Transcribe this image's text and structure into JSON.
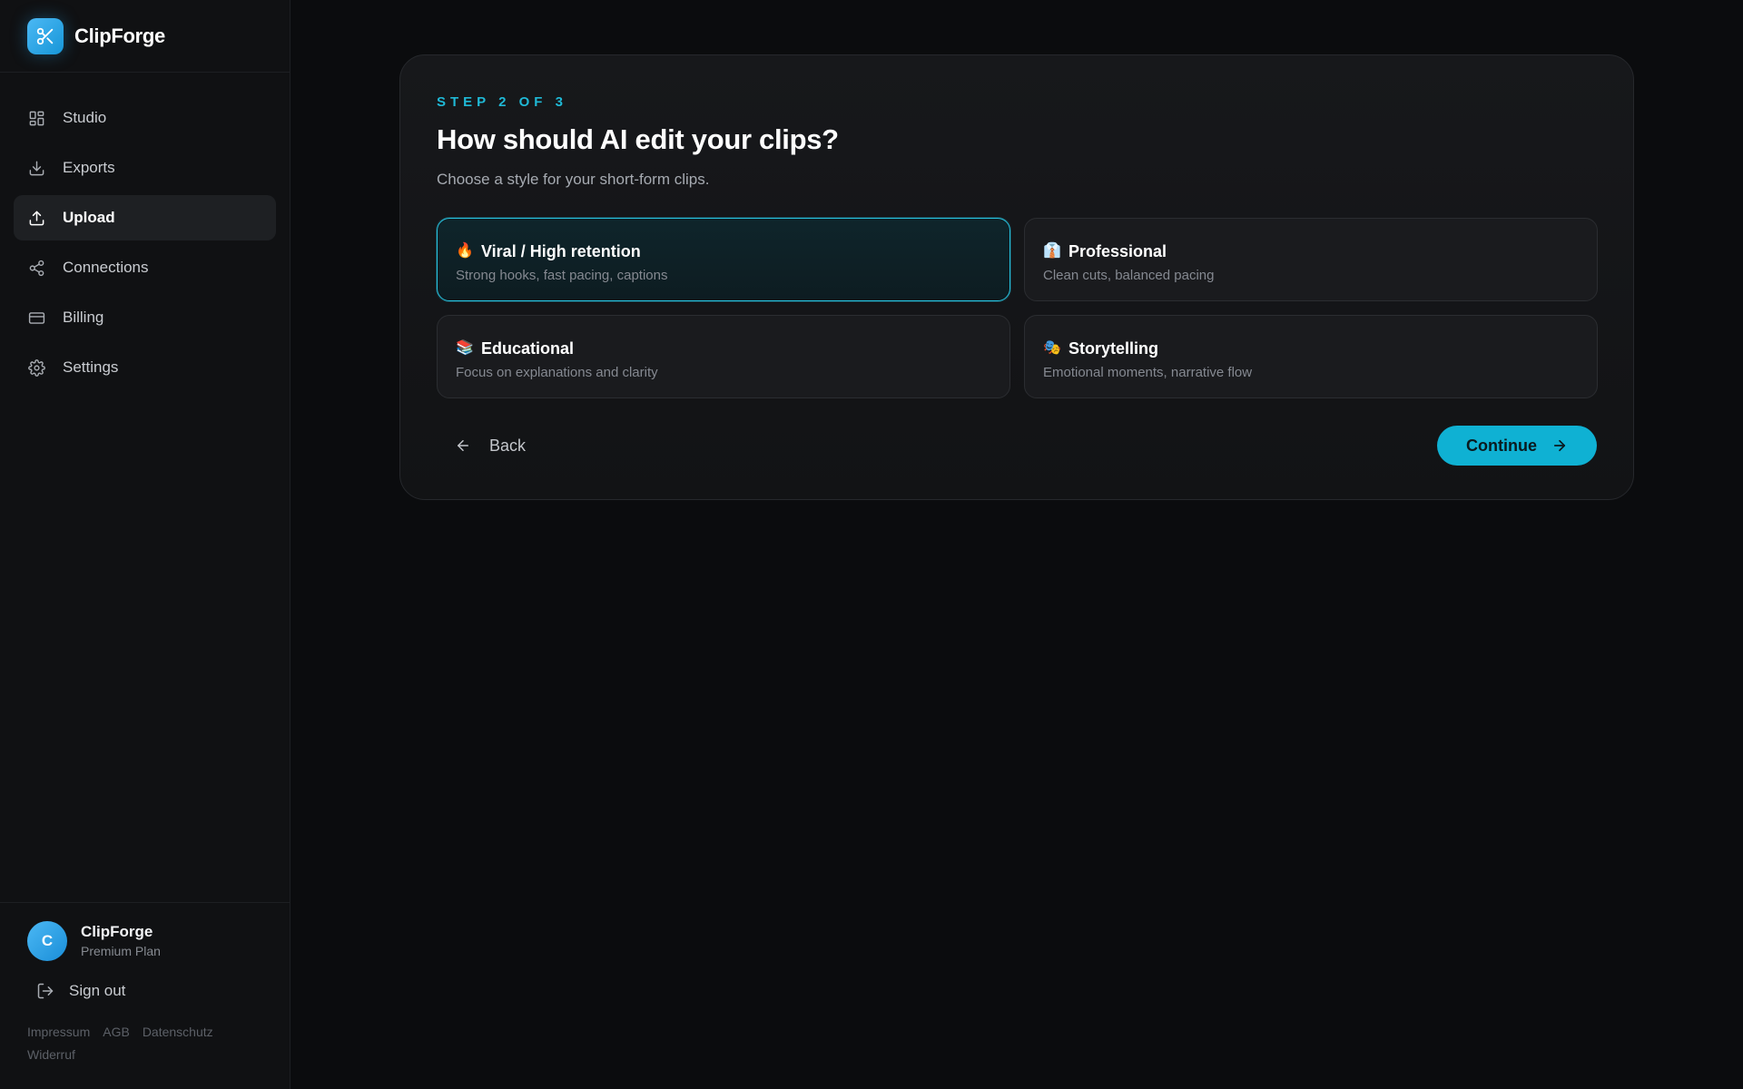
{
  "brand": {
    "name": "ClipForge",
    "logo_icon": "scissors-icon",
    "accent": "#1796d8"
  },
  "sidebar": {
    "items": [
      {
        "label": "Studio",
        "icon": "grid-icon",
        "active": false
      },
      {
        "label": "Exports",
        "icon": "download-icon",
        "active": false
      },
      {
        "label": "Upload",
        "icon": "upload-icon",
        "active": true
      },
      {
        "label": "Connections",
        "icon": "share-icon",
        "active": false
      },
      {
        "label": "Billing",
        "icon": "credit-card-icon",
        "active": false
      },
      {
        "label": "Settings",
        "icon": "gear-icon",
        "active": false
      }
    ]
  },
  "account": {
    "avatar_initial": "C",
    "name": "ClipForge",
    "plan": "Premium Plan"
  },
  "signout": {
    "label": "Sign out",
    "icon": "logout-icon"
  },
  "legal_links": [
    "Impressum",
    "AGB",
    "Datenschutz",
    "Widerruf"
  ],
  "wizard": {
    "step": "STEP 2 OF 3",
    "title": "How should AI edit your clips?",
    "subtitle": "Choose a style for your short-form clips.",
    "options": [
      {
        "emoji": "🔥",
        "title": "Viral / High retention",
        "description": "Strong hooks, fast pacing, captions",
        "selected": true
      },
      {
        "emoji": "👔",
        "title": "Professional",
        "description": "Clean cuts, balanced pacing",
        "selected": false
      },
      {
        "emoji": "📚",
        "title": "Educational",
        "description": "Focus on explanations and clarity",
        "selected": false
      },
      {
        "emoji": "🎭",
        "title": "Storytelling",
        "description": "Emotional moments, narrative flow",
        "selected": false
      }
    ],
    "back_label": "Back",
    "continue_label": "Continue",
    "accent_color": "#0fb1d3"
  }
}
